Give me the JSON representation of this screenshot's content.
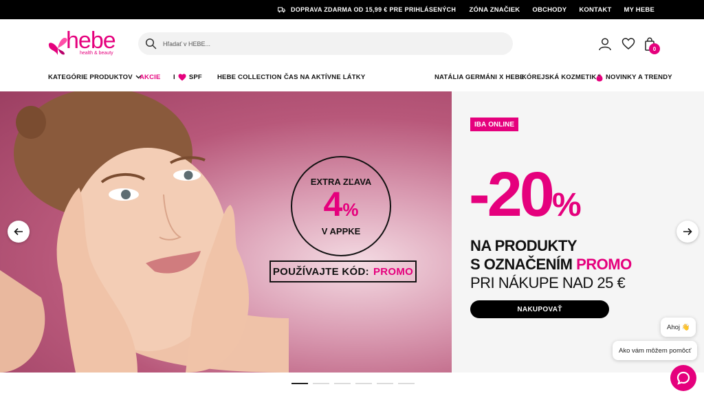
{
  "topbar": {
    "promo_text": "DOPRAVA ZDARMA OD 15,99 € PRE PRIHLÁSENÝCH",
    "links": [
      "ZÓNA ZNAČIEK",
      "OBCHODY",
      "KONTAKT",
      "MY HEBE"
    ]
  },
  "logo": {
    "text": "hebe",
    "tagline": "health & beauty"
  },
  "search": {
    "placeholder": "Hľadať v HEBE..."
  },
  "cart": {
    "count": "0"
  },
  "nav": {
    "categories": "KATEGÓRIE PRODUKTOV",
    "akcie": "AKCIE",
    "spf_prefix": "I",
    "spf_suffix": "SPF",
    "hebe_collection": "HEBE COLLECTION",
    "aktivne_latky": "ČAS NA AKTÍVNE LÁTKY",
    "natalia": "NATÁLIA GERMÁNI X HEBE",
    "korejska": "KÓREJSKÁ KOZMETIKA",
    "novinky": "NOVINKY A TRENDY"
  },
  "banner": {
    "circle_line1": "EXTRA ZĽAVA",
    "circle_value": "4",
    "circle_pct": "%",
    "circle_line3": "V APPKE",
    "code_label": "POUŽÍVAJTE KÓD:",
    "code_value": "PROMO",
    "tag_a": "IBA",
    "tag_b": "ONLINE",
    "discount": "-20",
    "discount_pct": "%",
    "line1": "NA PRODUKTY",
    "line2_a": "S OZNAČENÍM",
    "line2_b": "PROMO",
    "line3": "PRI NÁKUPE NAD 25 €",
    "cta": "NAKUPOVAŤ"
  },
  "slider": {
    "total_slides": 6,
    "active_slide": 1
  },
  "chat": {
    "greeting": "Ahoj 👋",
    "question": "Ako vám môžem pomôcť"
  },
  "colors": {
    "brand": "#e5007d",
    "dark": "#000000"
  }
}
